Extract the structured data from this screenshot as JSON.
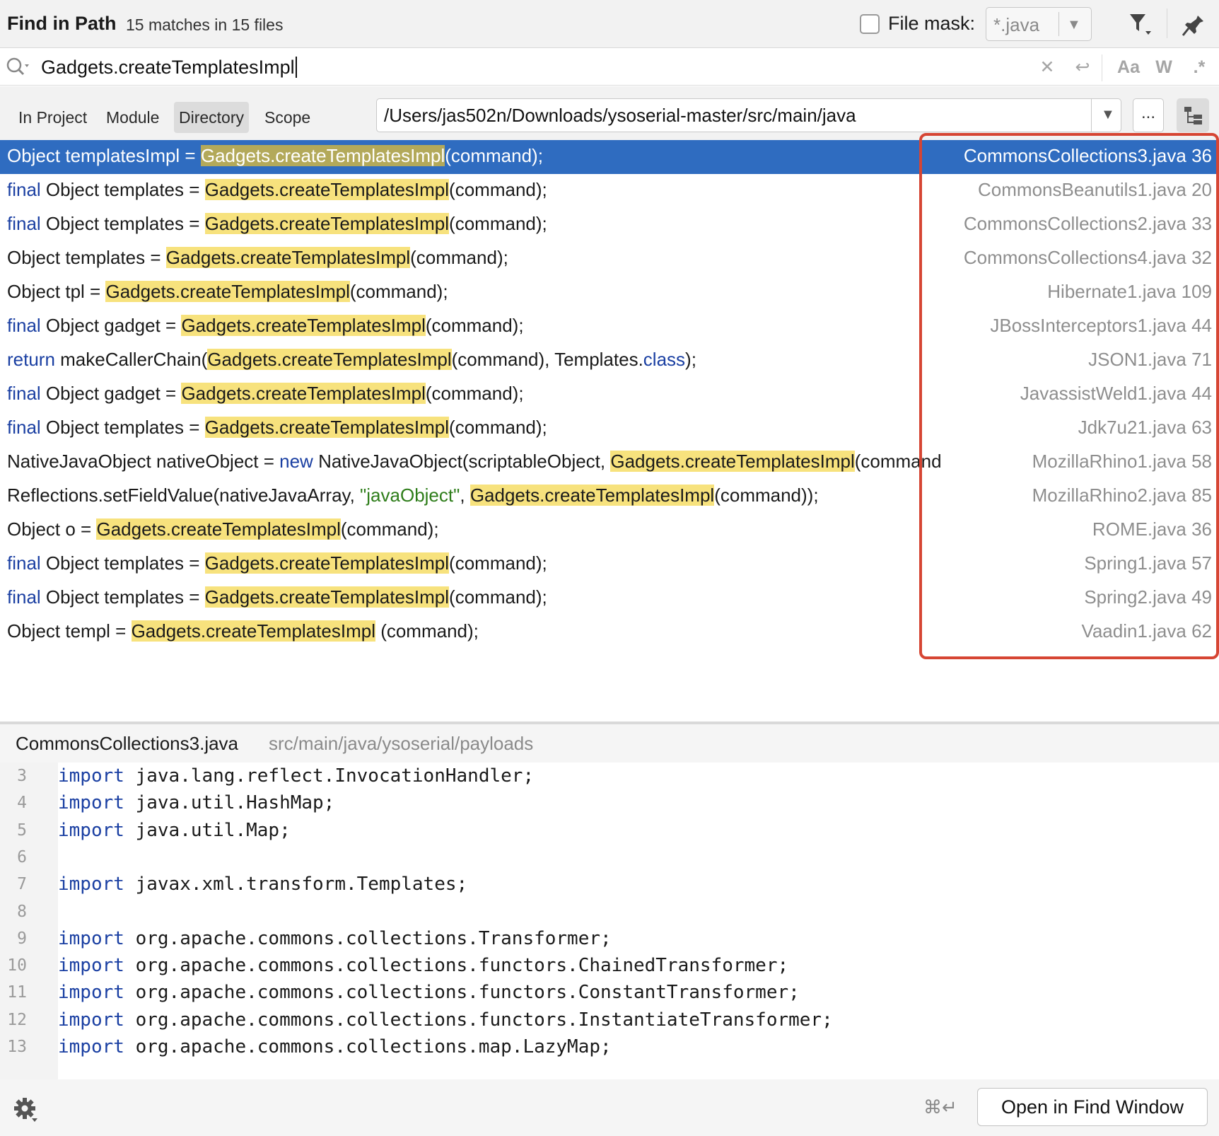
{
  "header": {
    "title": "Find in Path",
    "matches": "15 matches in 15 files",
    "file_mask_label": "File mask:",
    "file_mask_value": "*.java",
    "file_mask_checked": false
  },
  "search": {
    "query": "Gadgets.createTemplatesImpl",
    "options": {
      "match_case": "Aa",
      "words": "W",
      "regex": ".*"
    }
  },
  "scope": {
    "tabs": [
      "In Project",
      "Module",
      "Directory",
      "Scope"
    ],
    "active": "Directory",
    "directory": "/Users/jas502n/Downloads/ysoserial-master/src/main/java",
    "browse_label": "..."
  },
  "results": [
    {
      "selected": true,
      "parts": [
        [
          "t",
          "Object templatesImpl = "
        ],
        [
          "h",
          "Gadgets.createTemplatesImpl"
        ],
        [
          "t",
          "(command);"
        ]
      ],
      "file": "CommonsCollections3.java 36"
    },
    {
      "parts": [
        [
          "k",
          "final"
        ],
        [
          "t",
          " Object templates = "
        ],
        [
          "h",
          "Gadgets.createTemplatesImpl"
        ],
        [
          "t",
          "(command);"
        ]
      ],
      "file": "CommonsBeanutils1.java 20"
    },
    {
      "parts": [
        [
          "k",
          "final"
        ],
        [
          "t",
          " Object templates = "
        ],
        [
          "h",
          "Gadgets.createTemplatesImpl"
        ],
        [
          "t",
          "(command);"
        ]
      ],
      "file": "CommonsCollections2.java 33"
    },
    {
      "parts": [
        [
          "t",
          "Object templates = "
        ],
        [
          "h",
          "Gadgets.createTemplatesImpl"
        ],
        [
          "t",
          "(command);"
        ]
      ],
      "file": "CommonsCollections4.java 32"
    },
    {
      "parts": [
        [
          "t",
          "Object tpl = "
        ],
        [
          "h",
          "Gadgets.createTemplatesImpl"
        ],
        [
          "t",
          "(command);"
        ]
      ],
      "file": "Hibernate1.java 109"
    },
    {
      "parts": [
        [
          "k",
          "final"
        ],
        [
          "t",
          " Object gadget = "
        ],
        [
          "h",
          "Gadgets.createTemplatesImpl"
        ],
        [
          "t",
          "(command);"
        ]
      ],
      "file": "JBossInterceptors1.java 44"
    },
    {
      "parts": [
        [
          "k",
          "return"
        ],
        [
          "t",
          " makeCallerChain("
        ],
        [
          "h",
          "Gadgets.createTemplatesImpl"
        ],
        [
          "t",
          "(command), Templates."
        ],
        [
          "k",
          "class"
        ],
        [
          "t",
          ");"
        ]
      ],
      "file": "JSON1.java 71"
    },
    {
      "parts": [
        [
          "k",
          "final"
        ],
        [
          "t",
          " Object gadget = "
        ],
        [
          "h",
          "Gadgets.createTemplatesImpl"
        ],
        [
          "t",
          "(command);"
        ]
      ],
      "file": "JavassistWeld1.java 44"
    },
    {
      "parts": [
        [
          "k",
          "final"
        ],
        [
          "t",
          " Object templates = "
        ],
        [
          "h",
          "Gadgets.createTemplatesImpl"
        ],
        [
          "t",
          "(command);"
        ]
      ],
      "file": "Jdk7u21.java 63"
    },
    {
      "parts": [
        [
          "t",
          "NativeJavaObject nativeObject = "
        ],
        [
          "k",
          "new"
        ],
        [
          "t",
          " NativeJavaObject(scriptableObject, "
        ],
        [
          "h",
          "Gadgets.createTemplatesImpl"
        ],
        [
          "t",
          "(command"
        ]
      ],
      "file": "MozillaRhino1.java 58"
    },
    {
      "parts": [
        [
          "t",
          "Reflections.setFieldValue(nativeJavaArray, "
        ],
        [
          "s",
          "\"javaObject\""
        ],
        [
          "t",
          ", "
        ],
        [
          "h",
          "Gadgets.createTemplatesImpl"
        ],
        [
          "t",
          "(command));"
        ]
      ],
      "file": "MozillaRhino2.java 85"
    },
    {
      "parts": [
        [
          "t",
          "Object o = "
        ],
        [
          "h",
          "Gadgets.createTemplatesImpl"
        ],
        [
          "t",
          "(command);"
        ]
      ],
      "file": "ROME.java 36"
    },
    {
      "parts": [
        [
          "k",
          "final"
        ],
        [
          "t",
          " Object templates = "
        ],
        [
          "h",
          "Gadgets.createTemplatesImpl"
        ],
        [
          "t",
          "(command);"
        ]
      ],
      "file": "Spring1.java 57"
    },
    {
      "parts": [
        [
          "k",
          "final"
        ],
        [
          "t",
          " Object templates = "
        ],
        [
          "h",
          "Gadgets.createTemplatesImpl"
        ],
        [
          "t",
          "(command);"
        ]
      ],
      "file": "Spring2.java 49"
    },
    {
      "parts": [
        [
          "t",
          "Object templ = "
        ],
        [
          "h",
          "Gadgets.createTemplatesImpl"
        ],
        [
          "t",
          " (command);"
        ]
      ],
      "file": "Vaadin1.java 62"
    }
  ],
  "preview": {
    "file_name": "CommonsCollections3.java",
    "file_path": "src/main/java/ysoserial/payloads",
    "lines": [
      {
        "n": "3",
        "kw": "import",
        "rest": " java.lang.reflect.InvocationHandler;"
      },
      {
        "n": "4",
        "kw": "import",
        "rest": " java.util.HashMap;"
      },
      {
        "n": "5",
        "kw": "import",
        "rest": " java.util.Map;"
      },
      {
        "n": "6",
        "kw": "",
        "rest": ""
      },
      {
        "n": "7",
        "kw": "import",
        "rest": " javax.xml.transform.Templates;"
      },
      {
        "n": "8",
        "kw": "",
        "rest": ""
      },
      {
        "n": "9",
        "kw": "import",
        "rest": " org.apache.commons.collections.Transformer;"
      },
      {
        "n": "10",
        "kw": "import",
        "rest": " org.apache.commons.collections.functors.ChainedTransformer;"
      },
      {
        "n": "11",
        "kw": "import",
        "rest": " org.apache.commons.collections.functors.ConstantTransformer;"
      },
      {
        "n": "12",
        "kw": "import",
        "rest": " org.apache.commons.collections.functors.InstantiateTransformer;"
      },
      {
        "n": "13",
        "kw": "import",
        "rest": " org.apache.commons.collections.map.LazyMap;"
      }
    ]
  },
  "footer": {
    "shortcut": "⌘↵",
    "open_button": "Open in Find Window"
  },
  "colors": {
    "selection": "#2f6cc0",
    "highlight": "#f7e27d",
    "keyword": "#1a3fa2",
    "string": "#2e7d1a",
    "annotation_box": "#d64533"
  }
}
